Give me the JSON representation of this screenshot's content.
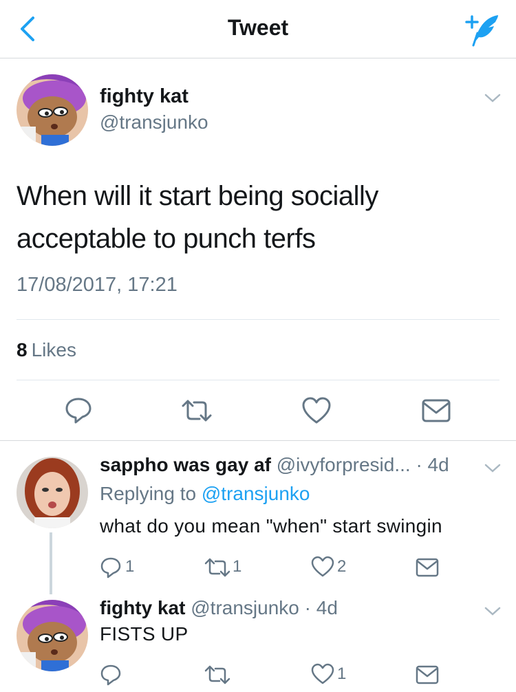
{
  "nav": {
    "title": "Tweet"
  },
  "tweet": {
    "name": "fighty kat",
    "handle": "@transjunko",
    "text_line1": "When will it start being socially",
    "text_line2": "acceptable to punch terfs",
    "timestamp": "17/08/2017, 17:21",
    "likes_count": "8",
    "likes_label": "Likes"
  },
  "replies": [
    {
      "name": "sappho was gay af",
      "handle": "@ivyforpresid...",
      "time": "· 4d",
      "replying_prefix": "Replying to",
      "replying_to": "@transjunko",
      "text": "what do you mean \"when\" start swingin",
      "reply_count": "1",
      "retweet_count": "1",
      "like_count": "2"
    },
    {
      "name": "fighty kat",
      "handle": "@transjunko",
      "time": "· 4d",
      "text": "FISTS UP",
      "like_count": "1"
    }
  ],
  "colors": {
    "accent": "#1da1f2",
    "muted": "#657786",
    "text": "#14171a",
    "divider": "#e1e8ed"
  }
}
